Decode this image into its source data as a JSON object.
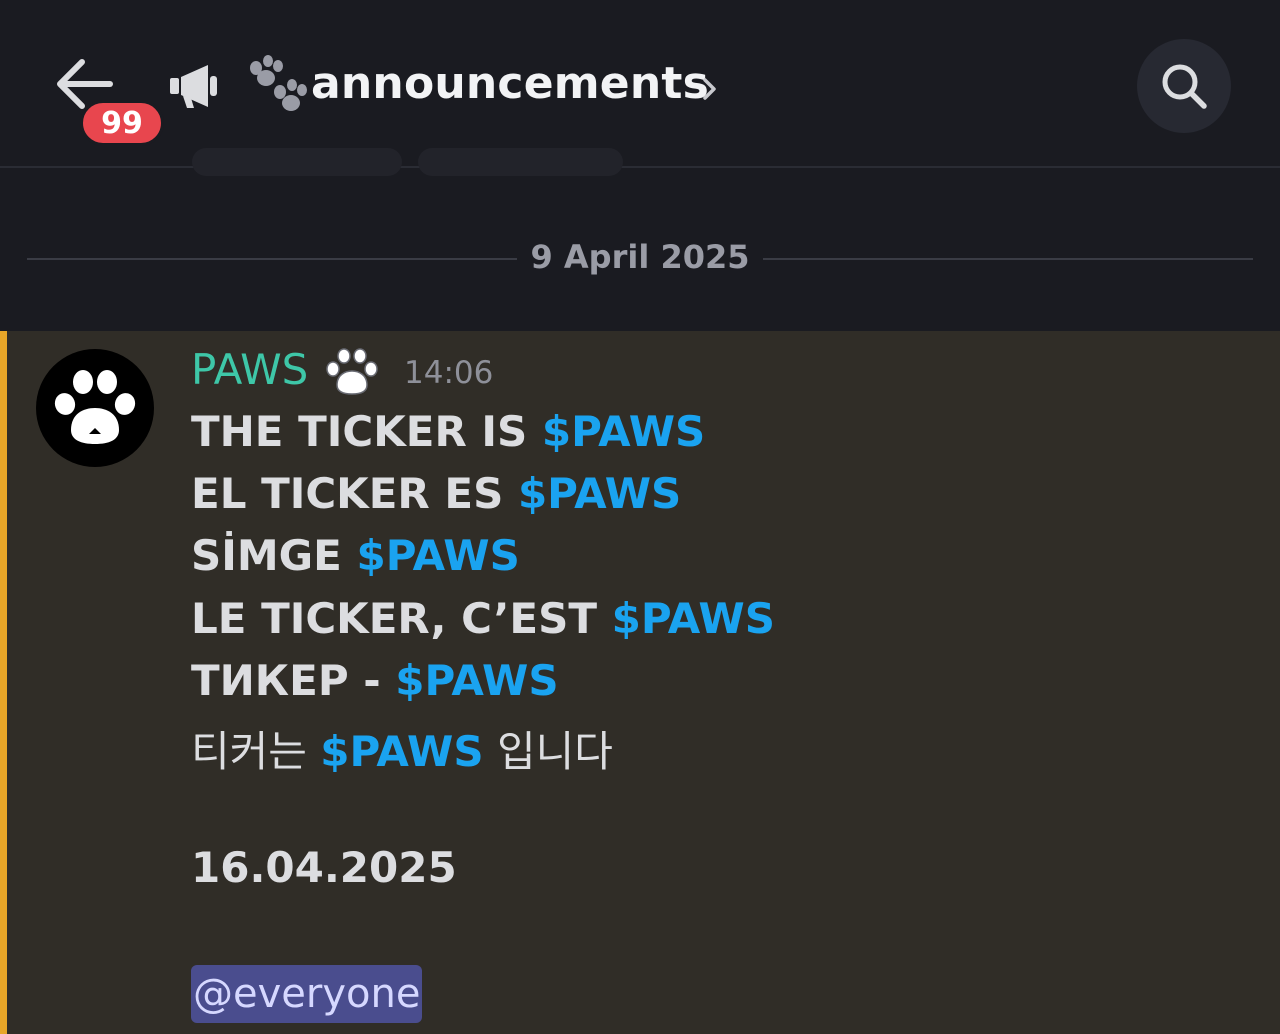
{
  "header": {
    "unread_count": "99",
    "channel_name": "announcements",
    "icons": [
      "back-arrow-icon",
      "megaphone-icon",
      "paws-emoji-icon",
      "chevron-right-icon",
      "search-icon"
    ]
  },
  "divider": {
    "date": "9 April 2025"
  },
  "message": {
    "author": "PAWS",
    "timestamp": "14:06",
    "lines": [
      {
        "text": "THE TICKER IS ",
        "ticker": "$PAWS",
        "suffix": ""
      },
      {
        "text": "EL TICKER ES ",
        "ticker": "$PAWS",
        "suffix": ""
      },
      {
        "text": "SİMGE ",
        "ticker": "$PAWS",
        "suffix": ""
      },
      {
        "text": "LE TICKER, C’EST ",
        "ticker": "$PAWS",
        "suffix": ""
      },
      {
        "text": "ТИКЕР - ",
        "ticker": "$PAWS",
        "suffix": ""
      },
      {
        "text": "티커는 ",
        "ticker": "$PAWS",
        "suffix": " 입니다"
      }
    ],
    "date_line": "16.04.2025",
    "mention": "@everyone"
  },
  "colors": {
    "background": "#1a1b21",
    "message_highlight": "#302d27",
    "highlight_bar": "#e8a628",
    "author": "#3ec7a8",
    "ticker": "#1aa3f0",
    "badge": "#e8464e",
    "mention_bg": "#4a4d8e"
  }
}
